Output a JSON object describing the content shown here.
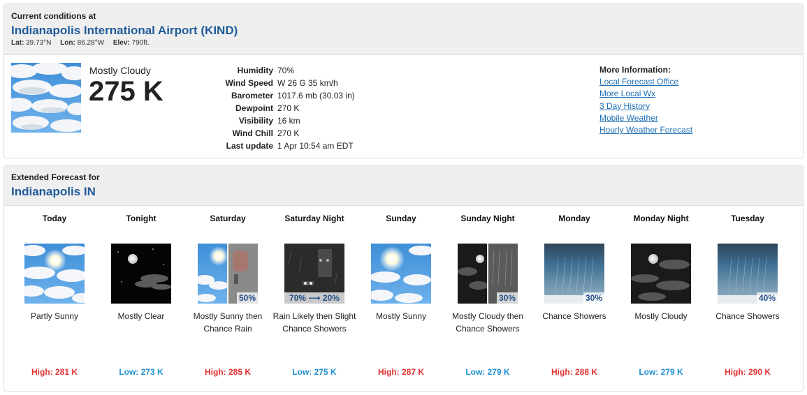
{
  "current": {
    "header_label": "Current conditions at",
    "station": "Indianapolis International Airport (KIND)",
    "lat_label": "Lat:",
    "lat": "39.73°N",
    "lon_label": "Lon:",
    "lon": "86.28°W",
    "elev_label": "Elev:",
    "elev": "790ft.",
    "condition": "Mostly Cloudy",
    "temperature": "275 K",
    "details": [
      {
        "label": "Humidity",
        "value": "70%"
      },
      {
        "label": "Wind Speed",
        "value": "W 26 G 35 km/h"
      },
      {
        "label": "Barometer",
        "value": "1017.6 mb (30.03 in)"
      },
      {
        "label": "Dewpoint",
        "value": "270 K"
      },
      {
        "label": "Visibility",
        "value": "16 km"
      },
      {
        "label": "Wind Chill",
        "value": "270 K"
      },
      {
        "label": "Last update",
        "value": "1 Apr 10:54 am EDT"
      }
    ],
    "more_info_title": "More Information:",
    "links": [
      "Local Forecast Office",
      "More Local Wx",
      "3 Day History",
      "Mobile Weather",
      "Hourly Weather Forecast"
    ]
  },
  "forecast": {
    "header_label": "Extended Forecast for",
    "location": "Indianapolis IN",
    "days": [
      {
        "name": "Today",
        "icon": "partly-sunny-icon",
        "pop": "",
        "desc": "Partly Sunny",
        "temp_label": "High: 281 K",
        "kind": "high"
      },
      {
        "name": "Tonight",
        "icon": "clear-night-icon",
        "pop": "",
        "desc": "Mostly Clear",
        "temp_label": "Low: 273 K",
        "kind": "low"
      },
      {
        "name": "Saturday",
        "icon": "sunny-then-rain-icon",
        "pop": "50%",
        "desc": "Mostly Sunny then Chance Rain",
        "temp_label": "High: 285 K",
        "kind": "high"
      },
      {
        "name": "Saturday Night",
        "icon": "rain-night-icon",
        "pop": "70% ⟶ 20%",
        "desc": "Rain Likely then Slight Chance Showers",
        "temp_label": "Low: 275 K",
        "kind": "low"
      },
      {
        "name": "Sunday",
        "icon": "mostly-sunny-icon",
        "pop": "",
        "desc": "Mostly Sunny",
        "temp_label": "High: 287 K",
        "kind": "high"
      },
      {
        "name": "Sunday Night",
        "icon": "cloudy-night-showers-icon",
        "pop": "30%",
        "desc": "Mostly Cloudy then Chance Showers",
        "temp_label": "Low: 279 K",
        "kind": "low"
      },
      {
        "name": "Monday",
        "icon": "showers-icon",
        "pop": "30%",
        "desc": "Chance Showers",
        "temp_label": "High: 288 K",
        "kind": "high"
      },
      {
        "name": "Monday Night",
        "icon": "cloudy-night-icon",
        "pop": "",
        "desc": "Mostly Cloudy",
        "temp_label": "Low: 279 K",
        "kind": "low"
      },
      {
        "name": "Tuesday",
        "icon": "showers-icon",
        "pop": "40%",
        "desc": "Chance Showers",
        "temp_label": "High: 290 K",
        "kind": "high"
      }
    ]
  },
  "colors": {
    "link": "#1f6fb5",
    "title": "#1f5b99",
    "high": "#e03232",
    "low": "#1e8fcf"
  }
}
